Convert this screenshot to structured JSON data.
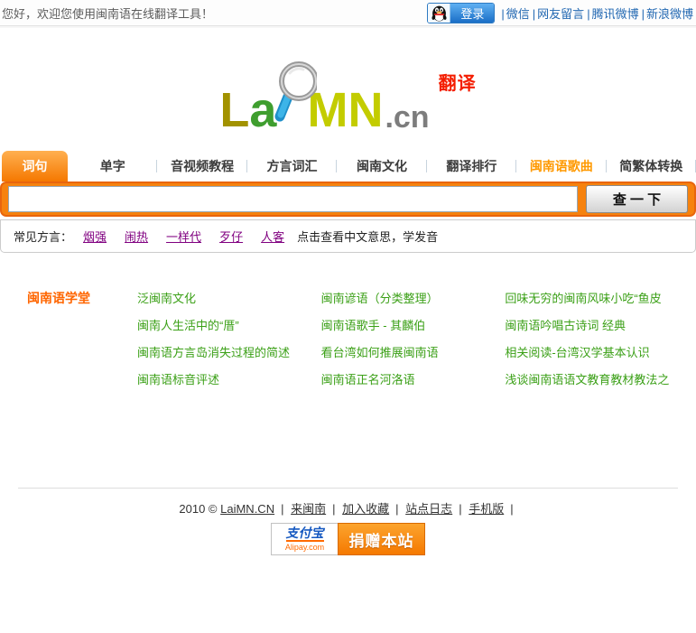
{
  "topbar": {
    "greeting": "您好，欢迎您使用闽南语在线翻译工具！",
    "login_label": "登录",
    "links": [
      {
        "label": "微信"
      },
      {
        "label": "网友留言"
      },
      {
        "label": "腾讯微博"
      },
      {
        "label": "新浪微博"
      }
    ]
  },
  "logo": {
    "part_l": "L",
    "part_a": "a",
    "part_mn": "MN",
    "part_cn": ".cn",
    "badge": "翻译"
  },
  "tabs": [
    {
      "label": "词句"
    },
    {
      "label": "单字"
    },
    {
      "label": "音视频教程"
    },
    {
      "label": "方言词汇"
    },
    {
      "label": "闽南文化"
    },
    {
      "label": "翻译排行"
    },
    {
      "label": "闽南语歌曲"
    },
    {
      "label": "简繁体转换"
    }
  ],
  "search": {
    "input_value": "",
    "button_label": "查 一 下"
  },
  "dialects": {
    "label": "常见方言：",
    "items": [
      {
        "label": "烟强"
      },
      {
        "label": "闹热"
      },
      {
        "label": "一样代"
      },
      {
        "label": "歹仔"
      },
      {
        "label": "人客"
      }
    ],
    "hint": "点击查看中文意思，学发音"
  },
  "school": {
    "title": "闽南语学堂",
    "col1": [
      {
        "label": "泛闽南文化"
      },
      {
        "label": "闽南人生活中的“厝”"
      },
      {
        "label": "闽南语方言岛消失过程的简述"
      },
      {
        "label": "闽南语标音评述"
      }
    ],
    "col2": [
      {
        "label": "闽南谚语（分类整理）"
      },
      {
        "label": "闽南语歌手 - 其麟伯"
      },
      {
        "label": "看台湾如何推展闽南语"
      },
      {
        "label": "闽南语正名河洛语"
      }
    ],
    "col3": [
      {
        "label": "回味无穷的闽南风味小吃“鱼皮"
      },
      {
        "label": "闽南语吟唱古诗词 经典"
      },
      {
        "label": "相关阅读-台湾汉学基本认识"
      },
      {
        "label": "浅谈闽南语语文教育教材教法之"
      }
    ]
  },
  "footer": {
    "copyright": "2010 ©",
    "links": [
      {
        "label": "LaiMN.CN"
      },
      {
        "label": "来闽南"
      },
      {
        "label": "加入收藏"
      },
      {
        "label": "站点日志"
      },
      {
        "label": "手机版"
      }
    ]
  },
  "donate": {
    "alipay_cn": "支付宝",
    "alipay_en": "Alipay.com",
    "button_label": "捐赠本站"
  },
  "colors": {
    "accent_orange": "#f6820e",
    "tab_highlight_orange": "#ff9900",
    "school_title_orange": "#ff6600",
    "link_green": "#3ba017",
    "visited_purple": "#800080",
    "badge_red": "#f41d00",
    "link_blue": "#2268b2"
  }
}
